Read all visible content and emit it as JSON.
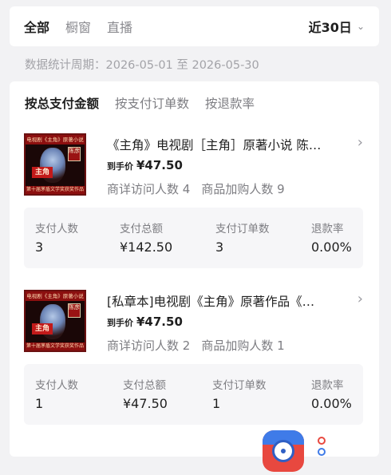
{
  "top_tabs": [
    "全部",
    "橱窗",
    "直播"
  ],
  "date_range_label": "近30日",
  "period": "数据统计周期：2026-05-01 至 2026-05-30",
  "sort_tabs": [
    "按总支付金额",
    "按支付订单数",
    "按退款率"
  ],
  "products": [
    {
      "title": "《主角》电视剧［主角］原著小说 陈…",
      "price_label": "到手价",
      "price": "¥47.50",
      "detail_visits": "商详访问人数 4",
      "cart_adds": "商品加购人数 9",
      "stats": [
        {
          "label": "支付人数",
          "value": "3"
        },
        {
          "label": "支付总额",
          "value": "¥142.50"
        },
        {
          "label": "支付订单数",
          "value": "3"
        },
        {
          "label": "退款率",
          "value": "0.00%"
        }
      ]
    },
    {
      "title": "[私章本]电视剧《主角》原著作品《…",
      "price_label": "到手价",
      "price": "¥47.50",
      "detail_visits": "商详访问人数 2",
      "cart_adds": "商品加购人数 1",
      "stats": [
        {
          "label": "支付人数",
          "value": "1"
        },
        {
          "label": "支付总额",
          "value": "¥47.50"
        },
        {
          "label": "支付订单数",
          "value": "1"
        },
        {
          "label": "退款率",
          "value": "0.00%"
        }
      ]
    }
  ],
  "thumbnail": {
    "top_text": "电视剧《主角》原著小说",
    "tag": "主角",
    "seal": "陈彦",
    "bottom_text": "第十届茅盾文学奖获奖作品"
  },
  "icons": {
    "date_chevron": "chevron-down-icon",
    "row_chevron": "chevron-right-icon",
    "floating_camera": "camera-icon",
    "floating_dots": "dots-icon"
  },
  "colors": {
    "page_bg": "#f2f2f4",
    "card_bg": "#ffffff",
    "muted_text": "#7d7d82",
    "fab_red": "#e8483f",
    "fab_blue": "#3f7be8"
  }
}
